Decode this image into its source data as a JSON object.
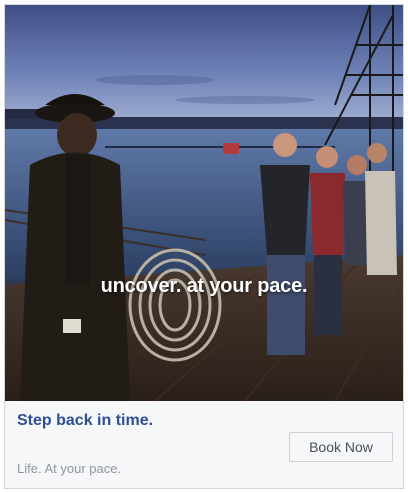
{
  "ad": {
    "overlay_text": "uncover. at your pace.",
    "headline": "Step back in time.",
    "subline": "Life. At your pace.",
    "cta_label": "Book Now",
    "colors": {
      "headline": "#2f4f95",
      "subline": "#90949c",
      "button_border": "#ced0d4"
    }
  }
}
